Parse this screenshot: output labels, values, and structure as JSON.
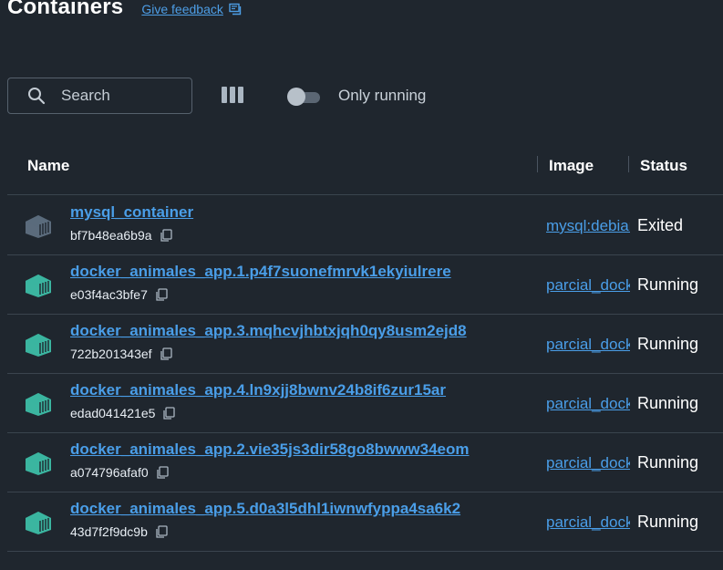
{
  "page": {
    "title": "Containers",
    "feedback_label": "Give feedback"
  },
  "toolbar": {
    "search_placeholder": "Search",
    "only_running_label": "Only running",
    "only_running_enabled": false
  },
  "table": {
    "headers": {
      "name": "Name",
      "image": "Image",
      "status": "Status"
    },
    "rows": [
      {
        "name": "mysql_container",
        "id": "bf7b48ea6b9a",
        "image": "mysql:debian",
        "status": "Exited",
        "icon": "container-exited-icon"
      },
      {
        "name": "docker_animales_app.1.p4f7suonefmrvk1ekyiulrere",
        "id": "e03f4ac3bfe7",
        "image": "parcial_docker",
        "status": "Running",
        "icon": "container-running-icon"
      },
      {
        "name": "docker_animales_app.3.mqhcvjhbtxjqh0qy8usm2ejd8",
        "id": "722b201343ef",
        "image": "parcial_docker",
        "status": "Running",
        "icon": "container-running-icon"
      },
      {
        "name": "docker_animales_app.4.ln9xjj8bwnv24b8if6zur15ar",
        "id": "edad041421e5",
        "image": "parcial_docker",
        "status": "Running",
        "icon": "container-running-icon"
      },
      {
        "name": "docker_animales_app.2.vie35js3dir58go8bwww34eom",
        "id": "a074796afaf0",
        "image": "parcial_docker",
        "status": "Running",
        "icon": "container-running-icon"
      },
      {
        "name": "docker_animales_app.5.d0a3l5dhl1iwnwfyppa4sa6k2",
        "id": "43d7f2f9dc9b",
        "image": "parcial_docker",
        "status": "Running",
        "icon": "container-running-icon"
      }
    ]
  },
  "colors": {
    "background": "#1f262e",
    "link": "#4a9ee8",
    "running_icon": "#3bb5a0",
    "exited_icon": "#5b6b7c"
  }
}
